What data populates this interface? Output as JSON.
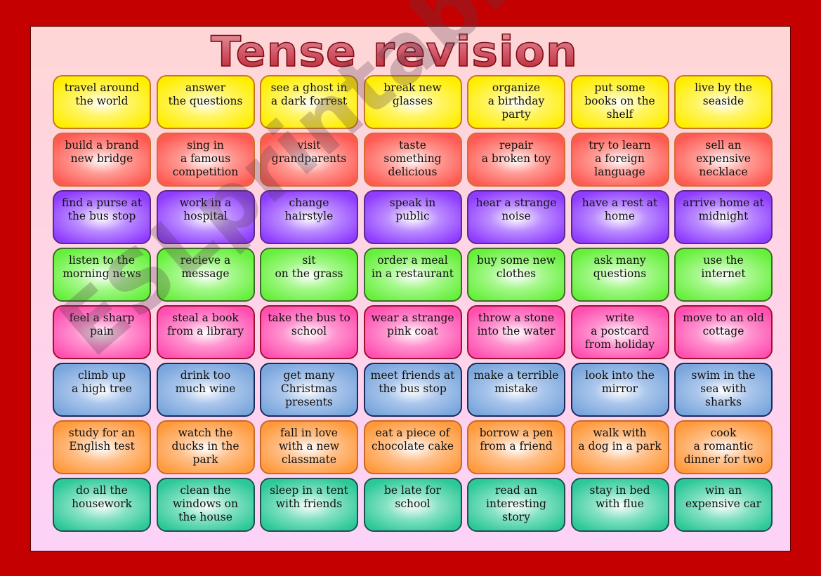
{
  "title": "Tense revision",
  "watermark": "ESLprintables.com",
  "rows": [
    {
      "color_name": "yellow",
      "colors": {
        "fill": "#ffee00",
        "mid": "#fff566",
        "border": "#c8781e"
      },
      "cards": [
        "travel around\nthe world",
        "answer\nthe questions",
        "see a ghost in\na dark forrest",
        "break new\nglasses",
        "organize\na birthday\nparty",
        "put some\nbooks on the\nshelf",
        "live by the\nseaside"
      ]
    },
    {
      "color_name": "red",
      "colors": {
        "fill": "#ff5a52",
        "mid": "#ff9a94",
        "border": "#d07030"
      },
      "cards": [
        "build a brand\nnew bridge",
        "sing in\na famous\ncompetition",
        "visit\ngrandparents",
        "taste\nsomething\ndelicious",
        "repair\na broken toy",
        "try to learn\na foreign\nlanguage",
        "sell an\nexpensive\nnecklace"
      ]
    },
    {
      "color_name": "purple",
      "colors": {
        "fill": "#8f3cff",
        "mid": "#bb8cff",
        "border": "#5a2a8a"
      },
      "cards": [
        "find a purse at\nthe bus stop",
        "work in a\nhospital",
        "change\nhairstyle",
        "speak in\npublic",
        "hear a strange\nnoise",
        "have a rest at\nhome",
        "arrive home at\nmidnight"
      ]
    },
    {
      "color_name": "green",
      "colors": {
        "fill": "#66f03c",
        "mid": "#a6f88c",
        "border": "#3c6a28"
      },
      "cards": [
        "listen to the\nmorning news",
        "recieve a\nmessage",
        "sit\non the grass",
        "order a meal\nin a restaurant",
        "buy some new\nclothes",
        "ask many\nquestions",
        "use the\ninternet"
      ]
    },
    {
      "color_name": "pink",
      "colors": {
        "fill": "#ff4fb0",
        "mid": "#ff94d0",
        "border": "#a01030"
      },
      "cards": [
        "feel a sharp\npain",
        "steal a book\nfrom a library",
        "take the bus to\nschool",
        "wear a strange\npink coat",
        "throw a stone\ninto the water",
        "write\na postcard\nfrom holiday",
        "move to an old\ncottage"
      ]
    },
    {
      "color_name": "blue",
      "colors": {
        "fill": "#7aa6dc",
        "mid": "#aac6ec",
        "border": "#1a2a5a"
      },
      "cards": [
        "climb up\na high tree",
        "drink too\nmuch wine",
        "get many\nChristmas\npresents",
        "meet friends at\nthe bus stop",
        "make a terrible\nmistake",
        "look into the\nmirror",
        "swim in the\nsea with\nsharks"
      ]
    },
    {
      "color_name": "orange",
      "colors": {
        "fill": "#ff9a3c",
        "mid": "#ffc08a",
        "border": "#c86a28"
      },
      "cards": [
        "study for an\nEnglish test",
        "watch the\nducks in the\npark",
        "fall in love\nwith a new\nclassmate",
        "eat a piece of\nchocolate cake",
        "borrow a pen\nfrom a friend",
        "walk with\na dog in a park",
        "cook\na romantic\ndinner for two"
      ]
    },
    {
      "color_name": "teal",
      "colors": {
        "fill": "#2cc898",
        "mid": "#86e2c4",
        "border": "#1e5050"
      },
      "cards": [
        "do all the\nhousework",
        "clean the\nwindows on\nthe house",
        "sleep in a tent\nwith friends",
        "be late for\nschool",
        "read an\ninteresting\nstory",
        "stay in bed\nwith flue",
        "win an\nexpensive car"
      ]
    }
  ]
}
